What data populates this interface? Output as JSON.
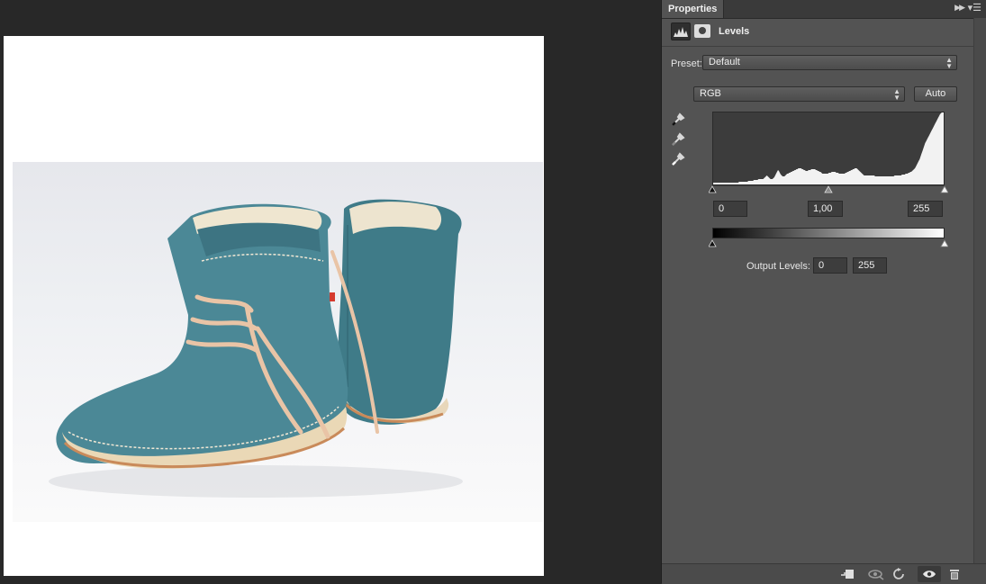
{
  "panel": {
    "tab_label": "Properties",
    "adjustment_title": "Levels",
    "preset_label": "Preset:",
    "preset_value": "Default",
    "channel_value": "RGB",
    "auto_label": "Auto",
    "input_black": "0",
    "input_gamma": "1,00",
    "input_white": "255",
    "output_label": "Output Levels:",
    "output_black": "0",
    "output_white": "255"
  },
  "icons": {
    "collapse": "double-chevron-right-icon",
    "menu": "panel-menu-icon",
    "levels": "levels-histogram-icon",
    "mask": "layer-mask-icon",
    "eyedroppers": [
      "black-point-eyedropper-icon",
      "gray-point-eyedropper-icon",
      "white-point-eyedropper-icon"
    ],
    "bottom": [
      "clip-to-layer-icon",
      "view-previous-state-icon",
      "reset-icon",
      "visibility-eye-icon",
      "trash-icon"
    ]
  },
  "histogram": [
    2,
    2,
    2,
    2,
    2,
    2,
    2,
    2,
    2,
    2,
    2,
    2,
    2,
    2,
    2,
    2,
    2,
    2,
    2,
    2,
    2,
    2,
    2,
    2,
    2,
    2,
    2,
    2,
    3,
    3,
    3,
    3,
    3,
    3,
    3,
    3,
    3,
    3,
    4,
    4,
    4,
    4,
    4,
    4,
    5,
    5,
    5,
    5,
    5,
    6,
    6,
    6,
    6,
    6,
    6,
    7,
    8,
    9,
    10,
    9,
    8,
    7,
    6,
    6,
    6,
    7,
    8,
    10,
    12,
    14,
    16,
    15,
    13,
    11,
    10,
    9,
    9,
    9,
    10,
    11,
    12,
    12,
    13,
    13,
    14,
    14,
    15,
    15,
    16,
    16,
    17,
    17,
    18,
    18,
    18,
    18,
    17,
    17,
    16,
    16,
    15,
    15,
    15,
    16,
    16,
    16,
    17,
    17,
    17,
    17,
    17,
    16,
    16,
    15,
    15,
    14,
    14,
    13,
    12,
    12,
    12,
    12,
    12,
    12,
    12,
    13,
    13,
    13,
    14,
    14,
    14,
    14,
    14,
    13,
    13,
    13,
    12,
    12,
    12,
    12,
    12,
    12,
    12,
    13,
    13,
    14,
    14,
    15,
    15,
    16,
    16,
    17,
    17,
    18,
    18,
    18,
    17,
    16,
    15,
    14,
    13,
    12,
    11,
    10,
    10,
    10,
    10,
    10,
    10,
    10,
    10,
    10,
    10,
    10,
    10,
    9,
    9,
    9,
    9,
    9,
    9,
    9,
    9,
    9,
    9,
    9,
    9,
    9,
    9,
    9,
    9,
    9,
    9,
    9,
    9,
    9,
    10,
    10,
    10,
    10,
    10,
    10,
    10,
    10,
    11,
    11,
    11,
    11,
    12,
    12,
    12,
    13,
    13,
    14,
    14,
    15,
    16,
    17,
    18,
    20,
    22,
    24,
    26,
    28,
    31,
    34,
    37,
    40,
    43,
    46,
    48,
    50,
    52,
    54,
    56,
    58,
    60,
    62,
    64,
    66,
    68,
    70,
    72,
    74,
    76,
    78,
    79,
    80,
    80,
    80
  ]
}
